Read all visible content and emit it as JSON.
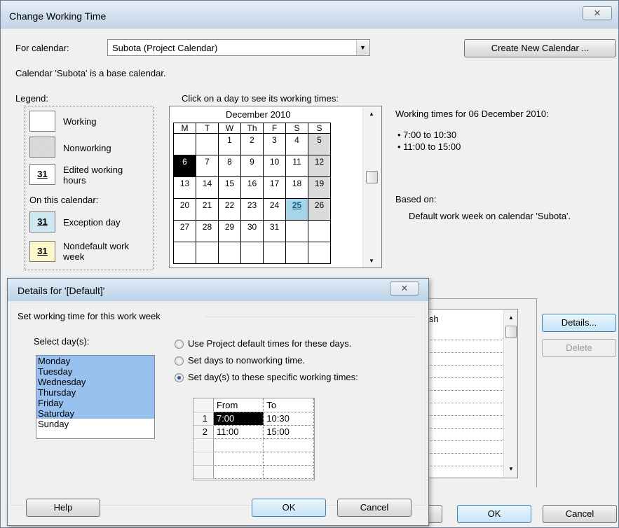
{
  "main_dialog": {
    "title": "Change Working Time",
    "close_glyph": "x",
    "for_calendar_label": "For calendar:",
    "calendar_value": "Subota (Project Calendar)",
    "create_new_calendar": "Create New Calendar ...",
    "base_calendar_note": "Calendar 'Subota' is a base calendar.",
    "legend_heading": "Legend:",
    "legend": {
      "working": "Working",
      "nonworking": "Nonworking",
      "edited_line1": "Edited working",
      "edited_line2": "hours",
      "on_this_calendar": "On this calendar:",
      "exception": "Exception day",
      "nondefault_line1": "Nondefault work",
      "nondefault_line2": "week",
      "swatch_number": "31"
    },
    "click_instruction": "Click on a day to see its working times:",
    "calendar": {
      "month": "December 2010",
      "weekdays": [
        "M",
        "T",
        "W",
        "Th",
        "F",
        "S",
        "S"
      ],
      "weeks": [
        [
          "",
          "",
          "1",
          "2",
          "3",
          "4",
          "5"
        ],
        [
          "6",
          "7",
          "8",
          "9",
          "10",
          "11",
          "12"
        ],
        [
          "13",
          "14",
          "15",
          "16",
          "17",
          "18",
          "19"
        ],
        [
          "20",
          "21",
          "22",
          "23",
          "24",
          "25",
          "26"
        ],
        [
          "27",
          "28",
          "29",
          "30",
          "31",
          "",
          ""
        ],
        [
          "",
          "",
          "",
          "",
          "",
          "",
          ""
        ]
      ]
    },
    "working_times_heading": "Working times for 06 December 2010:",
    "working_times": [
      "• 7:00 to 10:30",
      "• 11:00 to 15:00"
    ],
    "based_on_label": "Based on:",
    "based_on_text": "Default work week on calendar 'Subota'.",
    "list_header_partial": "sh",
    "details_button": "Details...",
    "delete_button": "Delete",
    "ok_button": "OK",
    "cancel_button": "Cancel",
    "hidden_button_fragment": "."
  },
  "details_dialog": {
    "title": "Details for '[Default]'",
    "close_glyph": "x",
    "group_label": "Set working time for this work week",
    "select_days_label": "Select day(s):",
    "days": [
      {
        "name": "Monday",
        "selected": true
      },
      {
        "name": "Tuesday",
        "selected": true
      },
      {
        "name": "Wednesday",
        "selected": true
      },
      {
        "name": "Thursday",
        "selected": true
      },
      {
        "name": "Friday",
        "selected": true
      },
      {
        "name": "Saturday",
        "selected": true
      },
      {
        "name": "Sunday",
        "selected": false
      }
    ],
    "radio_options": [
      {
        "label": "Use Project default times for these days.",
        "checked": false
      },
      {
        "label": "Set days to nonworking time.",
        "checked": false
      },
      {
        "label": "Set day(s) to these specific working times:",
        "checked": true
      }
    ],
    "grid": {
      "from_header": "From",
      "to_header": "To",
      "rows": [
        {
          "num": "1",
          "from": "7:00",
          "to": "10:30"
        },
        {
          "num": "2",
          "from": "11:00",
          "to": "15:00"
        },
        {
          "num": "",
          "from": "",
          "to": ""
        },
        {
          "num": "",
          "from": "",
          "to": ""
        },
        {
          "num": "",
          "from": "",
          "to": ""
        }
      ]
    },
    "help_button": "Help",
    "ok_button": "OK",
    "cancel_button": "Cancel"
  }
}
